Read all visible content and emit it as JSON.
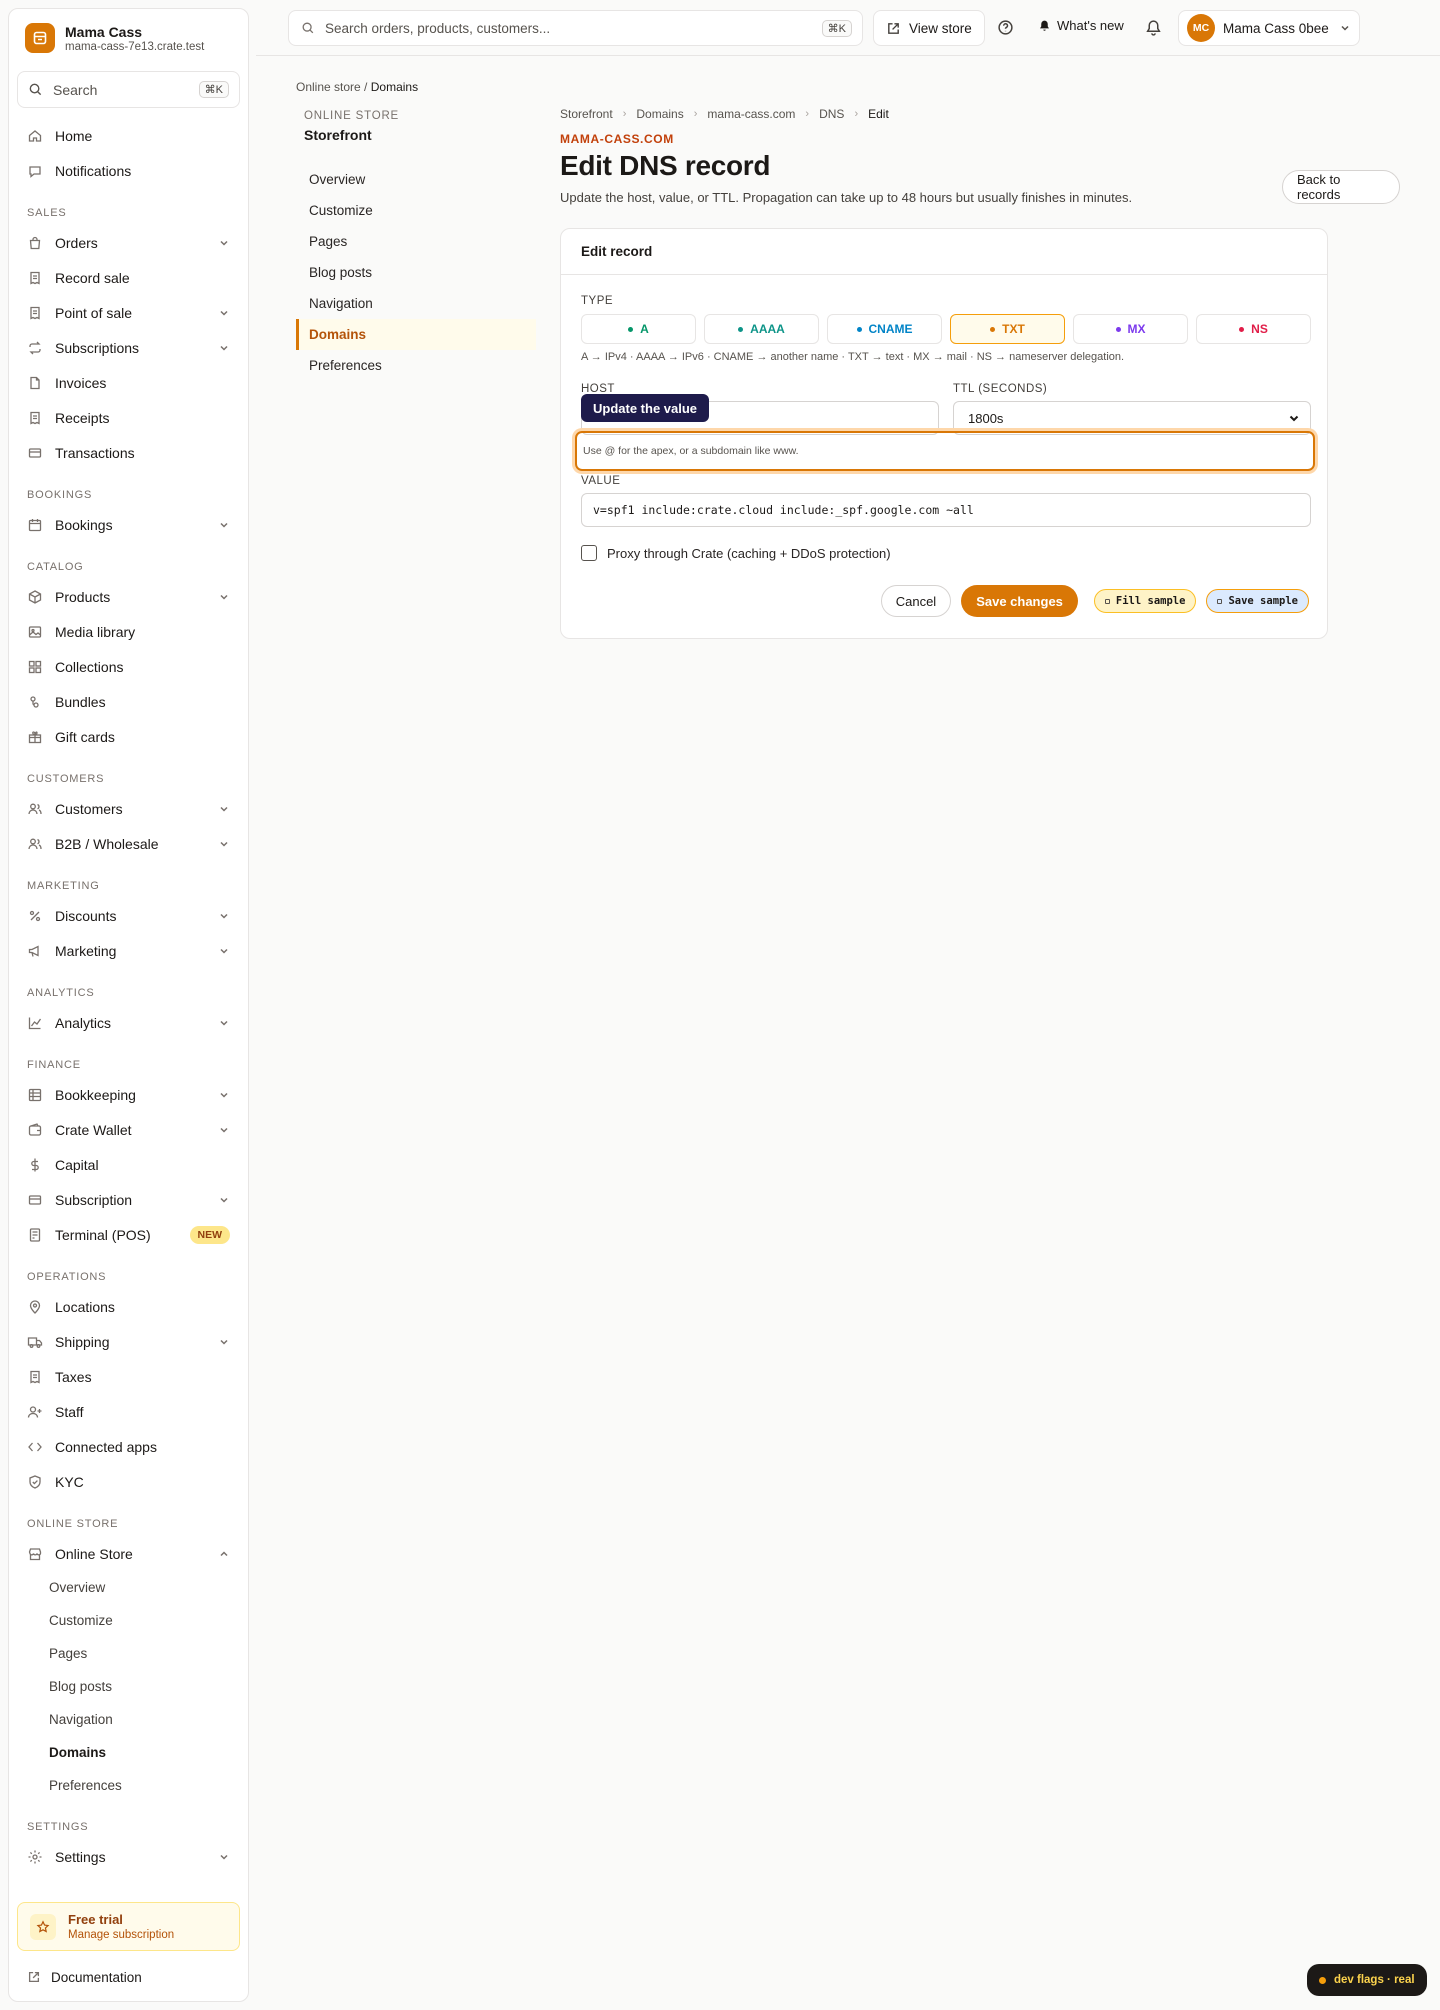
{
  "brand": {
    "name": "Mama Cass",
    "domain": "mama-cass-7e13.crate.test"
  },
  "sidebar": {
    "search_placeholder": "Search",
    "search_kbd": "⌘K",
    "top_items": [
      {
        "label": "Home",
        "icon": "home-icon"
      },
      {
        "label": "Notifications",
        "icon": "chat-bubble-icon"
      }
    ],
    "sections": [
      {
        "title": "SALES",
        "items": [
          {
            "label": "Orders",
            "icon": "bag-icon",
            "chevron": true
          },
          {
            "label": "Record sale",
            "icon": "receipt-icon",
            "chevron": false
          },
          {
            "label": "Point of sale",
            "icon": "receipt-icon",
            "chevron": true
          },
          {
            "label": "Subscriptions",
            "icon": "repeat-icon",
            "chevron": true
          },
          {
            "label": "Invoices",
            "icon": "document-icon",
            "chevron": false
          },
          {
            "label": "Receipts",
            "icon": "receipt-icon",
            "chevron": false
          },
          {
            "label": "Transactions",
            "icon": "card-icon",
            "chevron": false
          }
        ]
      },
      {
        "title": "BOOKINGS",
        "items": [
          {
            "label": "Bookings",
            "icon": "calendar-icon",
            "chevron": true
          }
        ]
      },
      {
        "title": "CATALOG",
        "items": [
          {
            "label": "Products",
            "icon": "box-icon",
            "chevron": true
          },
          {
            "label": "Media library",
            "icon": "image-icon",
            "chevron": false
          },
          {
            "label": "Collections",
            "icon": "grid-icon",
            "chevron": false
          },
          {
            "label": "Bundles",
            "icon": "bundle-icon",
            "chevron": false
          },
          {
            "label": "Gift cards",
            "icon": "gift-icon",
            "chevron": false
          }
        ]
      },
      {
        "title": "CUSTOMERS",
        "items": [
          {
            "label": "Customers",
            "icon": "users-icon",
            "chevron": true
          },
          {
            "label": "B2B / Wholesale",
            "icon": "users-icon",
            "chevron": true
          }
        ]
      },
      {
        "title": "MARKETING",
        "items": [
          {
            "label": "Discounts",
            "icon": "percent-icon",
            "chevron": true
          },
          {
            "label": "Marketing",
            "icon": "megaphone-icon",
            "chevron": true
          }
        ]
      },
      {
        "title": "ANALYTICS",
        "items": [
          {
            "label": "Analytics",
            "icon": "chart-icon",
            "chevron": true
          }
        ]
      },
      {
        "title": "FINANCE",
        "items": [
          {
            "label": "Bookkeeping",
            "icon": "ledger-icon",
            "chevron": true
          },
          {
            "label": "Crate Wallet",
            "icon": "wallet-icon",
            "chevron": true
          },
          {
            "label": "Capital",
            "icon": "dollar-icon",
            "chevron": false
          },
          {
            "label": "Subscription",
            "icon": "card-icon",
            "chevron": true
          },
          {
            "label": "Terminal (POS)",
            "icon": "terminal-icon",
            "chevron": false,
            "badge": "NEW"
          }
        ]
      },
      {
        "title": "OPERATIONS",
        "items": [
          {
            "label": "Locations",
            "icon": "pin-icon",
            "chevron": false
          },
          {
            "label": "Shipping",
            "icon": "truck-icon",
            "chevron": true
          },
          {
            "label": "Taxes",
            "icon": "receipt-icon",
            "chevron": false
          },
          {
            "label": "Staff",
            "icon": "user-plus-icon",
            "chevron": false
          },
          {
            "label": "Connected apps",
            "icon": "code-icon",
            "chevron": false
          },
          {
            "label": "KYC",
            "icon": "shield-check-icon",
            "chevron": false
          }
        ]
      },
      {
        "title": "ONLINE STORE",
        "items": [
          {
            "label": "Online Store",
            "icon": "store-icon",
            "chevron": true,
            "expanded": true
          }
        ]
      }
    ],
    "online_store_sub": [
      "Overview",
      "Customize",
      "Pages",
      "Blog posts",
      "Navigation",
      "Domains",
      "Preferences"
    ],
    "online_store_active": "Domains",
    "settings_section": "SETTINGS",
    "settings_label": "Settings",
    "trial": {
      "title": "Free trial",
      "subtitle": "Manage subscription"
    },
    "docs_label": "Documentation"
  },
  "topbar": {
    "search_placeholder": "Search orders, products, customers...",
    "search_kbd": "⌘K",
    "view_store": "View store",
    "whats_new": "What's new",
    "user_initials": "MC",
    "user_name": "Mama Cass 0bee"
  },
  "page": {
    "top_crumb_parent": "Online store",
    "top_crumb_sep": "/",
    "top_crumb_current": "Domains",
    "subnav_eyebrow": "ONLINE STORE",
    "subnav_title": "Storefront",
    "subnav_items": [
      "Overview",
      "Customize",
      "Pages",
      "Blog posts",
      "Navigation",
      "Domains",
      "Preferences"
    ],
    "subnav_active": "Domains",
    "crumbs": [
      "Storefront",
      "Domains",
      "mama-cass.com",
      "DNS",
      "Edit"
    ],
    "eyebrow": "MAMA-CASS.COM",
    "title": "Edit DNS record",
    "subtitle": "Update the host, value, or TTL. Propagation can take up to 48 hours but usually finishes in minutes.",
    "back_button": "Back to records"
  },
  "form": {
    "card_title": "Edit record",
    "type_label": "TYPE",
    "types": [
      {
        "label": "A",
        "color": "#059669",
        "active": false
      },
      {
        "label": "AAAA",
        "color": "#0d9488",
        "active": false
      },
      {
        "label": "CNAME",
        "color": "#0284c7",
        "active": false
      },
      {
        "label": "TXT",
        "color": "#d97706",
        "active": true
      },
      {
        "label": "MX",
        "color": "#7c3aed",
        "active": false
      },
      {
        "label": "NS",
        "color": "#e11d48",
        "active": false
      }
    ],
    "type_hint": "A → IPv4 · AAAA → IPv6 · CNAME → another name · TXT → text · MX → mail · NS → nameserver delegation.",
    "host_label": "HOST",
    "host_value": "",
    "ttl_label": "TTL (SECONDS)",
    "ttl_value": "1800s",
    "tooltip": "Update the value",
    "host_hint": "Use @ for the apex, or a subdomain like www.",
    "value_label": "VALUE",
    "value": "v=spf1 include:crate.cloud include:_spf.google.com ~all",
    "proxy_label": "Proxy through Crate (caching + DDoS protection)",
    "cancel": "Cancel",
    "save": "Save changes",
    "dev_fill": "Fill sample",
    "dev_save": "Save sample"
  },
  "devflags": "dev flags · real",
  "colors": {
    "accent": "#d97706",
    "text": "#1c1917"
  }
}
